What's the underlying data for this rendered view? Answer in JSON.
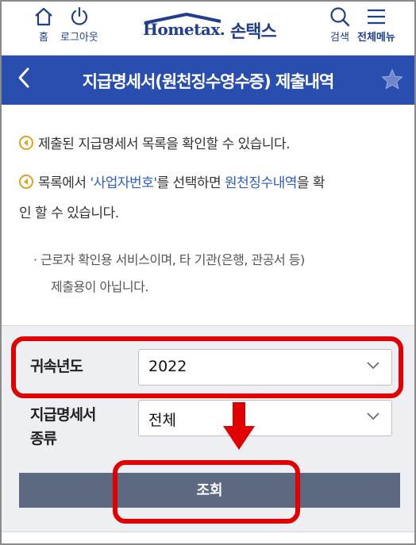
{
  "header": {
    "home_label": "홈",
    "logout_label": "로그아웃",
    "logo_brand": "Hometax.",
    "logo_korean": "손택스",
    "search_label": "검색",
    "menu_label": "전체메뉴"
  },
  "titlebar": {
    "title": "지급명세서(원천징수영수증) 제출내역",
    "back": "<"
  },
  "info": {
    "bullet1": "제출된 지급명세서 목록을 확인할 수 있습니다.",
    "bullet2_pre": "목록에서 ",
    "bullet2_link1": "'사업자번호'",
    "bullet2_mid": "를 선택하면 ",
    "bullet2_link2": "원천징수내역",
    "bullet2_post": "을 확",
    "bullet2_line2": "인 할 수 있습니다.",
    "note_line1": "· 근로자 확인용 서비스이며, 타 기관(은행, 관공서 등)",
    "note_line2": "제출용이 아닙니다."
  },
  "form": {
    "year_label": "귀속년도",
    "year_value": "2022",
    "type_label_line1": "지급명세서",
    "type_label_line2": "종류",
    "type_value": "전체",
    "search_button": "조회"
  },
  "colors": {
    "header_blue": "#1f3f8c",
    "title_bar": "#2a4eb0",
    "highlight_red": "#e10000",
    "button_gray": "#5d6980",
    "link_blue": "#2a5cc4"
  }
}
